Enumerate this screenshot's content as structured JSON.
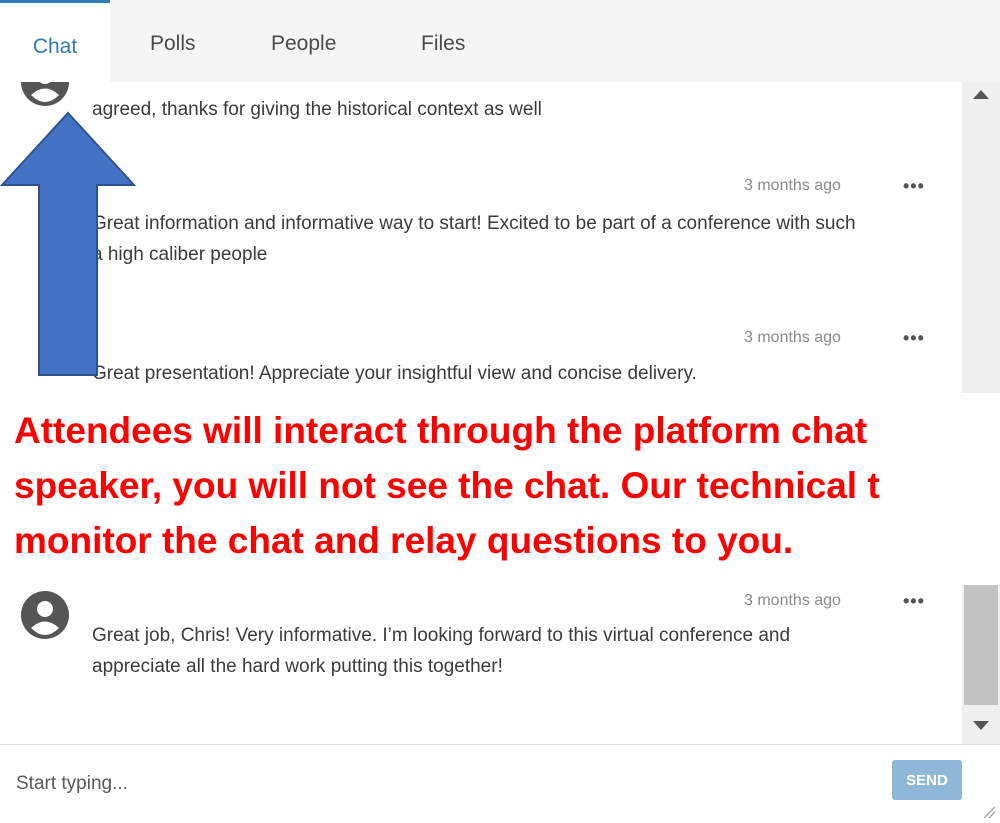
{
  "tabs": [
    {
      "label": "Chat",
      "active": true
    },
    {
      "label": "Polls",
      "active": false
    },
    {
      "label": "People",
      "active": false
    },
    {
      "label": "Files",
      "active": false
    }
  ],
  "messages": [
    {
      "text": "agreed, thanks for giving the historical context as well",
      "timestamp": ""
    },
    {
      "text": "Great information and informative way to start! Excited to be part of a conference with such a high caliber people",
      "timestamp": "3 months ago"
    },
    {
      "text": "Great presentation! Appreciate your insightful view and concise delivery.",
      "timestamp": "3 months ago"
    },
    {
      "text": "Great job, Chris! Very informative. I’m looking forward to this virtual conference and appreciate all the hard work putting this together!",
      "timestamp": "3 months ago"
    }
  ],
  "more_label": "•••",
  "composer": {
    "placeholder": "Start typing...",
    "send_label": "SEND"
  },
  "annotation": {
    "line1": "Attendees will interact through the platform chat",
    "line2": "speaker, you will not see the chat. Our technical t",
    "line3": "monitor the chat and relay questions to you."
  },
  "colors": {
    "accent": "#2f79b7",
    "send_button": "#8fb7d6",
    "annotation_text": "#ff0000",
    "arrow_fill": "#4472c4"
  },
  "icons": {
    "avatar": "user-avatar-icon",
    "more": "more-options-icon",
    "scroll_up": "arrow-up-icon",
    "scroll_down": "arrow-down-icon",
    "resize": "resize-handle-icon",
    "arrow": "up-arrow-icon"
  }
}
